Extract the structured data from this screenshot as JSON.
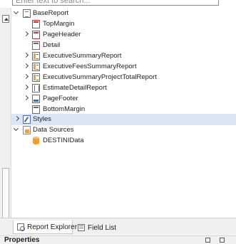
{
  "search": {
    "placeholder": "Enter text to search..."
  },
  "tree": {
    "root": {
      "label": "BaseReport",
      "icon": "report-icon"
    },
    "bands": [
      {
        "label": "TopMargin",
        "icon": "band-icon"
      },
      {
        "label": "PageHeader",
        "icon": "band-icon"
      },
      {
        "label": "Detail",
        "icon": "band-icon"
      },
      {
        "label": "ExecutiveSummaryReport",
        "icon": "subreport-icon"
      },
      {
        "label": "ExecutiveFeesSummaryReport",
        "icon": "subreport-icon"
      },
      {
        "label": "ExecutiveSummaryProjectTotalReport",
        "icon": "subreport-icon"
      },
      {
        "label": "EstimateDetailReport",
        "icon": "detail-report-icon"
      },
      {
        "label": "PageFooter",
        "icon": "page-footer-icon"
      },
      {
        "label": "BottomMargin",
        "icon": "band-icon"
      }
    ],
    "styles": {
      "label": "Styles",
      "icon": "styles-icon"
    },
    "data_sources": {
      "label": "Data Sources",
      "icon": "data-sources-icon"
    },
    "data_source_items": [
      {
        "label": "DESTINIData",
        "icon": "database-icon"
      }
    ]
  },
  "tabs": [
    {
      "label": "Report Explorer",
      "icon": "report-explorer-icon"
    },
    {
      "label": "Field List",
      "icon": "field-list-icon"
    }
  ],
  "properties": {
    "title": "Properties"
  }
}
